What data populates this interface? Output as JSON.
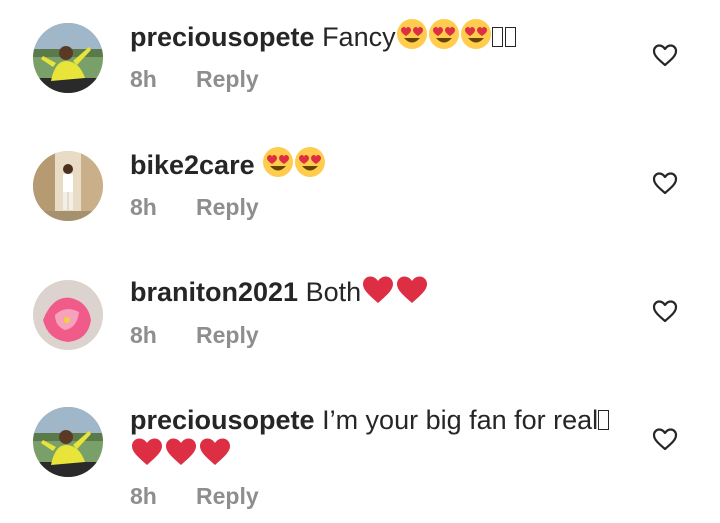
{
  "comments": [
    {
      "username": "preciousopete",
      "text": "Fancy",
      "text_line2": "",
      "emojis": [
        "heart-eyes-emoji",
        "heart-eyes-emoji",
        "heart-eyes-emoji"
      ],
      "trailing_missing_glyphs": 2,
      "time": "8h",
      "reply_label": "Reply"
    },
    {
      "username": "bike2care",
      "text": "",
      "text_line2": "",
      "emojis": [
        "heart-eyes-emoji",
        "heart-eyes-emoji"
      ],
      "trailing_missing_glyphs": 0,
      "time": "8h",
      "reply_label": "Reply"
    },
    {
      "username": "braniton2021",
      "text": "Both",
      "text_line2": "",
      "emojis": [
        "red-heart-emoji",
        "red-heart-emoji"
      ],
      "trailing_missing_glyphs": 0,
      "time": "8h",
      "reply_label": "Reply"
    },
    {
      "username": "preciousopete",
      "text": "I’m your big fan for real",
      "text_line2": "",
      "emojis": [
        "red-heart-emoji",
        "red-heart-emoji",
        "red-heart-emoji"
      ],
      "trailing_missing_glyphs": 1,
      "time": "8h",
      "reply_label": "Reply"
    }
  ],
  "colors": {
    "username": "#262626",
    "meta": "#8e8e8e",
    "like_icon": "#262626",
    "red_heart": "#dd2e44",
    "emoji_face": "#ffcc4d"
  },
  "icons": {
    "like": "heart-outline-icon"
  }
}
